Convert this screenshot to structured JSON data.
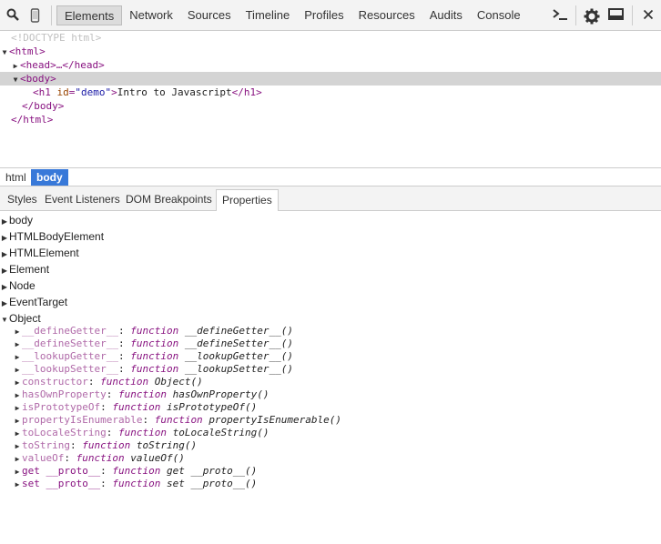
{
  "toolbar": {
    "tabs": [
      "Elements",
      "Network",
      "Sources",
      "Timeline",
      "Profiles",
      "Resources",
      "Audits",
      "Console"
    ],
    "active_tab": "Elements",
    "icons": [
      "search-icon",
      "device-icon",
      "console-drawer-icon",
      "settings-gear-icon",
      "dock-icon",
      "close-icon"
    ]
  },
  "dom": {
    "doctype": "<!DOCTYPE html>",
    "html_open": "<html>",
    "head": "<head>…</head>",
    "body_open": "<body>",
    "h1_open_tag": "h1",
    "h1_attr_name": "id",
    "h1_attr_value": "\"demo\"",
    "h1_text": "Intro to Javascript",
    "h1_close": "</h1>",
    "body_close": "</body>",
    "html_close": "</html>"
  },
  "breadcrumbs": [
    "html",
    "body"
  ],
  "subtabs": [
    "Styles",
    "Event Listeners",
    "DOM Breakpoints",
    "Properties"
  ],
  "active_subtab": "Properties",
  "properties": {
    "groups": [
      "body",
      "HTMLBodyElement",
      "HTMLElement",
      "Element",
      "Node",
      "EventTarget",
      "Object"
    ],
    "object_entries": [
      {
        "name": "__defineGetter__",
        "type": "function",
        "sig": "__defineGetter__()",
        "inherited": true
      },
      {
        "name": "__defineSetter__",
        "type": "function",
        "sig": "__defineSetter__()",
        "inherited": true
      },
      {
        "name": "__lookupGetter__",
        "type": "function",
        "sig": "__lookupGetter__()",
        "inherited": true
      },
      {
        "name": "__lookupSetter__",
        "type": "function",
        "sig": "__lookupSetter__()",
        "inherited": true
      },
      {
        "name": "constructor",
        "type": "function",
        "sig": "Object()",
        "inherited": true
      },
      {
        "name": "hasOwnProperty",
        "type": "function",
        "sig": "hasOwnProperty()",
        "inherited": true
      },
      {
        "name": "isPrototypeOf",
        "type": "function",
        "sig": "isPrototypeOf()",
        "inherited": true
      },
      {
        "name": "propertyIsEnumerable",
        "type": "function",
        "sig": "propertyIsEnumerable()",
        "inherited": true
      },
      {
        "name": "toLocaleString",
        "type": "function",
        "sig": "toLocaleString()",
        "inherited": true
      },
      {
        "name": "toString",
        "type": "function",
        "sig": "toString()",
        "inherited": true
      },
      {
        "name": "valueOf",
        "type": "function",
        "sig": "valueOf()",
        "inherited": true
      },
      {
        "name": "get __proto__",
        "type": "function",
        "sig": "get __proto__()",
        "inherited": false
      },
      {
        "name": "set __proto__",
        "type": "function",
        "sig": "set __proto__()",
        "inherited": false
      }
    ]
  }
}
